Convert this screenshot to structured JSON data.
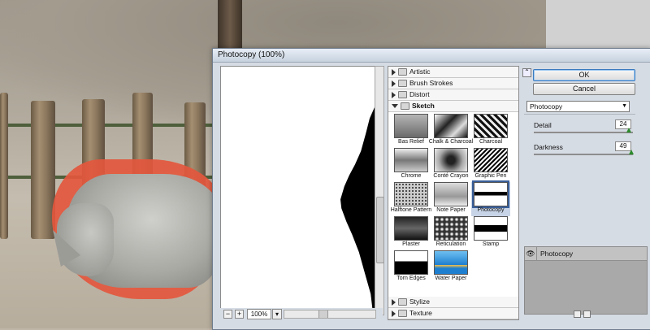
{
  "dialog": {
    "title": "Photocopy (100%)",
    "ok_label": "OK",
    "cancel_label": "Cancel"
  },
  "preview": {
    "zoom_value": "100%",
    "zoom_out_symbol": "−",
    "zoom_in_symbol": "+"
  },
  "gallery": {
    "categories_top": [
      {
        "label": "Artistic"
      },
      {
        "label": "Brush Strokes"
      },
      {
        "label": "Distort"
      },
      {
        "label": "Sketch"
      }
    ],
    "sketch_filters": [
      {
        "label": "Bas Relief"
      },
      {
        "label": "Chalk & Charcoal"
      },
      {
        "label": "Charcoal"
      },
      {
        "label": "Chrome"
      },
      {
        "label": "Conté Crayon"
      },
      {
        "label": "Graphic Pen"
      },
      {
        "label": "Halftone Pattern"
      },
      {
        "label": "Note Paper"
      },
      {
        "label": "Photocopy"
      },
      {
        "label": "Plaster"
      },
      {
        "label": "Reticulation"
      },
      {
        "label": "Stamp"
      },
      {
        "label": "Torn Edges"
      },
      {
        "label": "Water Paper"
      }
    ],
    "categories_bottom": [
      {
        "label": "Stylize"
      },
      {
        "label": "Texture"
      }
    ],
    "selected": "Photocopy"
  },
  "settings": {
    "filter_select": "Photocopy",
    "detail_label": "Detail",
    "detail_value": "24",
    "detail_fraction": 0.96,
    "darkness_label": "Darkness",
    "darkness_value": "49",
    "darkness_fraction": 0.98
  },
  "effect_layers": [
    {
      "label": "Photocopy"
    }
  ],
  "colors": {
    "selection_outline": "#e3573d",
    "dialog_bg": "#d6dce4",
    "slider_knob": "#2b8a2b"
  }
}
